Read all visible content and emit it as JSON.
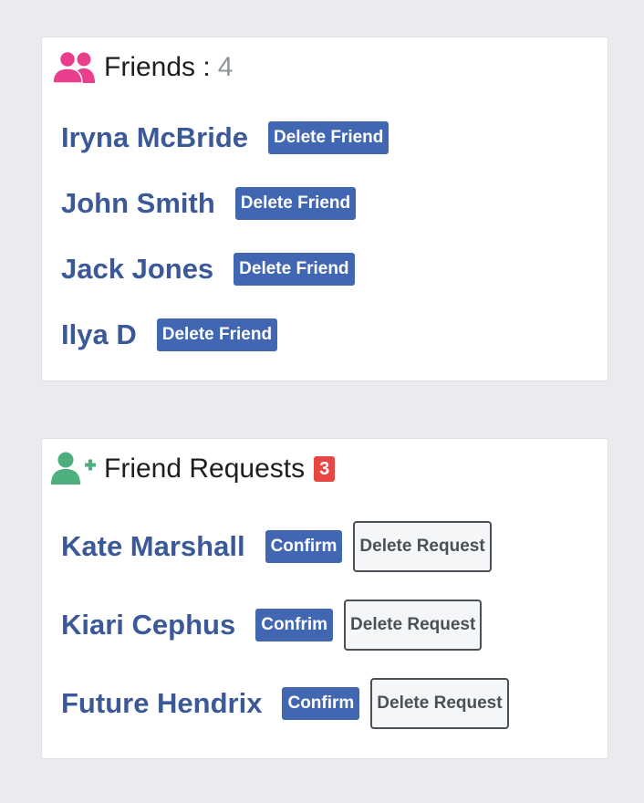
{
  "friends": {
    "title": "Friends :",
    "count": "4",
    "icon": "friends-icon",
    "icon_color": "#e83e8c",
    "items": [
      {
        "name": "Iryna McBride",
        "action": "Delete Friend"
      },
      {
        "name": "John Smith",
        "action": "Delete Friend"
      },
      {
        "name": "Jack Jones",
        "action": "Delete Friend"
      },
      {
        "name": "Ilya D",
        "action": "Delete Friend"
      }
    ]
  },
  "requests": {
    "title": "Friend Requests",
    "badge": "3",
    "icon": "user-plus-icon",
    "icon_color": "#4caf7d",
    "badge_color": "#e84545",
    "items": [
      {
        "name": "Kate Marshall",
        "confirm": "Confirm",
        "delete": "Delete Request"
      },
      {
        "name": "Kiari Cephus",
        "confirm": "Confrim",
        "delete": "Delete Request"
      },
      {
        "name": "Future Hendrix",
        "confirm": "Confirm",
        "delete": "Delete Request"
      }
    ]
  },
  "colors": {
    "background": "#e9ebee",
    "link_blue": "#3b5998",
    "button_blue": "#4267b2"
  }
}
